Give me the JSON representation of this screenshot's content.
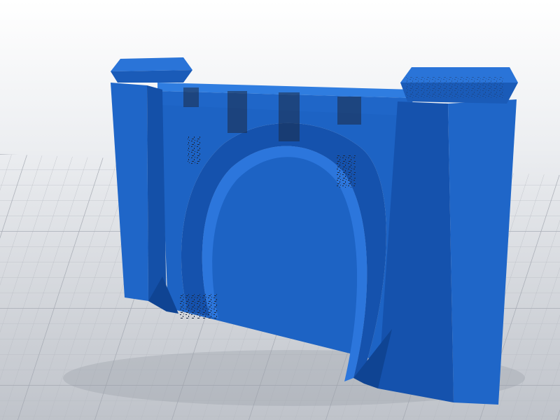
{
  "scene": {
    "subject": "3d-arch-bridge-model",
    "colors": {
      "background_top": "#ffffff",
      "grid_floor": "#c9ccd2",
      "grid_line": "#b3b7bf",
      "model_light": "#2f7de0",
      "model_mid": "#1f66c8",
      "model_dark": "#1250a6",
      "model_shadow": "#0b3a7d",
      "texture_dark": "#1c2a44"
    }
  }
}
